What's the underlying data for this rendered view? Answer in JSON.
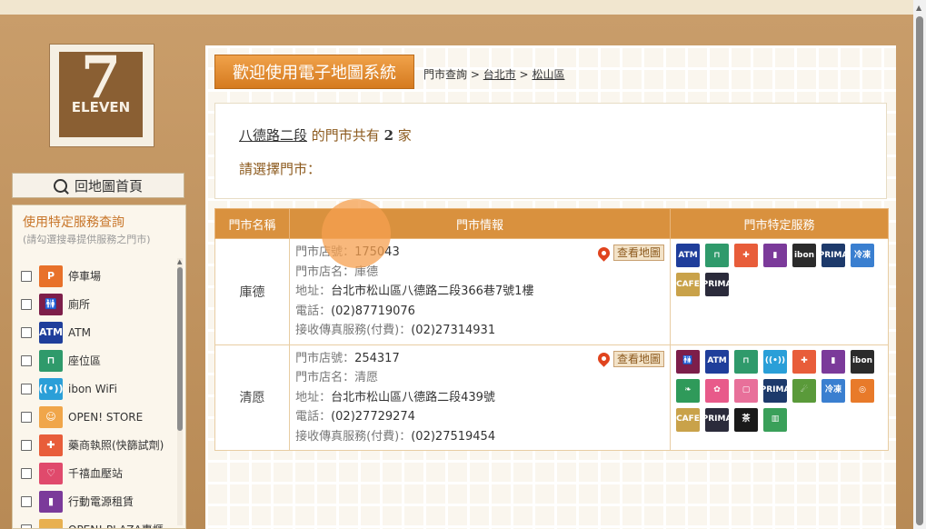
{
  "logo": {
    "seven": "7",
    "eleven": "ELEVEN"
  },
  "home_button": {
    "label": "回地圖首頁"
  },
  "service_panel": {
    "title": "使用特定服務查詢",
    "subtitle": "(請勾選搜尋提供服務之門市)",
    "items": [
      {
        "label": "停車場",
        "icon": "parking-icon",
        "color": "#e8712a",
        "glyph": "P"
      },
      {
        "label": "廁所",
        "icon": "toilet-icon",
        "color": "#7d1e4a",
        "glyph": "🚻"
      },
      {
        "label": "ATM",
        "icon": "atm-icon",
        "color": "#1f3e9b",
        "glyph": "ATM"
      },
      {
        "label": "座位區",
        "icon": "seating-icon",
        "color": "#2f9a6b",
        "glyph": "⊓"
      },
      {
        "label": "ibon WiFi",
        "icon": "wifi-icon",
        "color": "#2a9fd8",
        "glyph": "((•))"
      },
      {
        "label": "OPEN! STORE",
        "icon": "open-store-icon",
        "color": "#f0a64a",
        "glyph": "☺"
      },
      {
        "label": "藥商執照(快篩試劑)",
        "icon": "pharmacy-icon",
        "color": "#e85d3a",
        "glyph": "✚"
      },
      {
        "label": "千禧血壓站",
        "icon": "blood-pressure-icon",
        "color": "#e04a6c",
        "glyph": "♡"
      },
      {
        "label": "行動電源租賃",
        "icon": "power-bank-icon",
        "color": "#7b3a9a",
        "glyph": "▮"
      },
      {
        "label": "OPEN! PLAZA專櫃",
        "icon": "open-plaza-icon",
        "color": "#e8b050",
        "glyph": "▭"
      }
    ]
  },
  "header": {
    "welcome": "歡迎使用電子地圖系統",
    "crumb_prefix": "門市查詢 >",
    "crumb_city": "台北市",
    "crumb_sep": ">",
    "crumb_district": "松山區"
  },
  "summary": {
    "road": "八德路二段",
    "text1": " 的門市共有 ",
    "count": "2",
    "text2": " 家",
    "choose": "請選擇門市："
  },
  "table": {
    "headers": [
      "門市名稱",
      "門市情報",
      "門市特定服務"
    ],
    "view_map_label": "查看地圖",
    "rows": [
      {
        "name": "庫德",
        "id_label": "門市店號：",
        "id": "175043",
        "name_label": "門市店名：",
        "store_name": "庫德",
        "addr_label": "地址：",
        "addr": "台北市松山區八德路二段366巷7號1樓",
        "tel_label": "電話：",
        "tel": "(02)87719076",
        "fax_label": "接收傳真服務(付費)：",
        "fax": "(02)27314931",
        "services": [
          {
            "icon": "atm-icon",
            "text": "ATM",
            "color": "#1f3e9b"
          },
          {
            "icon": "seating-icon",
            "text": "⊓",
            "color": "#2f9a6b"
          },
          {
            "icon": "pharmacy-icon",
            "text": "✚",
            "color": "#e85d3a"
          },
          {
            "icon": "power-bank-icon",
            "text": "▮",
            "color": "#7b3a9a"
          },
          {
            "icon": "ibon-icon",
            "text": "ibon",
            "color": "#2b2b2b"
          },
          {
            "icon": "city-prima-icon",
            "text": "PRIMA",
            "color": "#1d3a6b"
          },
          {
            "icon": "cold-chain-icon",
            "text": "冷凍",
            "color": "#3a7fd0"
          },
          {
            "icon": "city-cafe-icon",
            "text": "CAFE",
            "color": "#c9a24a"
          },
          {
            "icon": "city-prima-cafe-icon",
            "text": "PRIMA",
            "color": "#2b2b3b"
          }
        ]
      },
      {
        "name": "清愿",
        "id_label": "門市店號：",
        "id": "254317",
        "name_label": "門市店名：",
        "store_name": "清愿",
        "addr_label": "地址：",
        "addr": "台北市松山區八德路二段439號",
        "tel_label": "電話：",
        "tel": "(02)27729274",
        "fax_label": "接收傳真服務(付費)：",
        "fax": "(02)27519454",
        "services": [
          {
            "icon": "toilet-icon",
            "text": "🚻",
            "color": "#7d1e4a"
          },
          {
            "icon": "atm-icon",
            "text": "ATM",
            "color": "#1f3e9b"
          },
          {
            "icon": "seating-icon",
            "text": "⊓",
            "color": "#2f9a6b"
          },
          {
            "icon": "wifi-icon",
            "text": "((•))",
            "color": "#2a9fd8"
          },
          {
            "icon": "pharmacy-icon",
            "text": "✚",
            "color": "#e85d3a"
          },
          {
            "icon": "power-bank-icon",
            "text": "▮",
            "color": "#7b3a9a"
          },
          {
            "icon": "ibon-icon",
            "text": "ibon",
            "color": "#2b2b2b"
          },
          {
            "icon": "leaf-icon",
            "text": "❧",
            "color": "#2f9a5a"
          },
          {
            "icon": "snack-icon",
            "text": "✿",
            "color": "#e85a8a"
          },
          {
            "icon": "bag-icon",
            "text": "▢",
            "color": "#e8709a"
          },
          {
            "icon": "city-prima-icon",
            "text": "PRIMA",
            "color": "#1d3a6b"
          },
          {
            "icon": "delivery-icon",
            "text": "☄",
            "color": "#5a9a3a"
          },
          {
            "icon": "cold-chain-icon",
            "text": "冷凍",
            "color": "#3a7fd0"
          },
          {
            "icon": "cake-icon",
            "text": "◎",
            "color": "#e87a2a"
          },
          {
            "icon": "city-cafe-icon",
            "text": "CAFE",
            "color": "#c9a24a"
          },
          {
            "icon": "city-prima-cafe-icon",
            "text": "PRIMA",
            "color": "#2b2b3b"
          },
          {
            "icon": "tea-icon",
            "text": "茶",
            "color": "#1a1a1a"
          },
          {
            "icon": "coupon-icon",
            "text": "▥",
            "color": "#3aa05a"
          }
        ]
      }
    ]
  }
}
